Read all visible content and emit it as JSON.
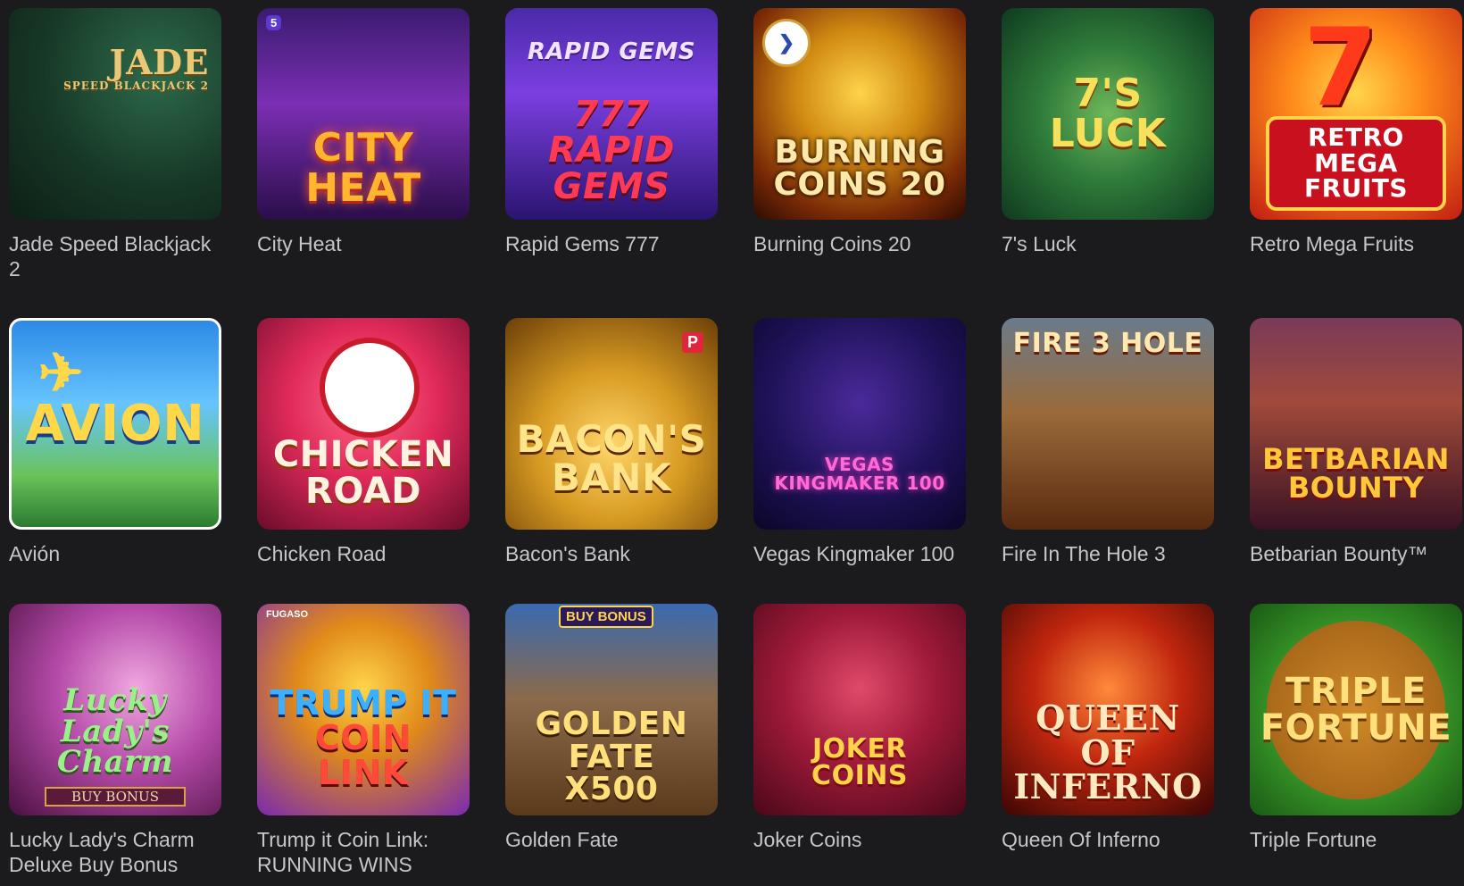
{
  "games": [
    {
      "title": "Jade Speed Blackjack 2",
      "art_text": "JADE",
      "art_sub": "SPEED BLACKJACK 2",
      "accent": "#e9c878"
    },
    {
      "title": "City Heat",
      "art_text": "CITY HEAT",
      "accent": "#ffb52e",
      "badge": "5"
    },
    {
      "title": "Rapid Gems 777",
      "art_top": "RAPID GEMS",
      "art_text": "777 RAPID GEMS",
      "accent": "#ff3a55"
    },
    {
      "title": "Burning Coins 20",
      "art_text": "BURNING COINS 20",
      "accent": "#ffe9a8"
    },
    {
      "title": "7's Luck",
      "art_text": "7'S LUCK",
      "accent": "#f7e15a"
    },
    {
      "title": "Retro Mega Fruits",
      "art_text": "RETRO MEGA FRUITS",
      "accent": "#c8101e"
    },
    {
      "title": "Avión",
      "art_text": "AVION",
      "accent": "#ffd84a"
    },
    {
      "title": "Chicken Road",
      "art_text": "CHICKEN ROAD",
      "accent": "#fff2e0"
    },
    {
      "title": "Bacon's Bank",
      "art_text": "BACON'S BANK",
      "accent": "#ffe48a",
      "badge": "P"
    },
    {
      "title": "Vegas Kingmaker 100",
      "art_text": "VEGAS KINGMAKER 100",
      "accent": "#ff6ad6"
    },
    {
      "title": "Fire In The Hole 3",
      "art_text": "FIRE 3 HOLE",
      "accent": "#ffe9b0"
    },
    {
      "title": "Betbarian Bounty™",
      "art_text": "BETBARIAN BOUNTY",
      "accent": "#ffc83a"
    },
    {
      "title": "Lucky Lady's Charm Deluxe Buy Bonus",
      "art_text": "Lucky Lady's Charm",
      "art_sub": "BUY BONUS",
      "accent": "#9bf08a"
    },
    {
      "title": "Trump it Coin Link: RUNNING WINS",
      "art_text": "TRUMP IT",
      "art_sub": "COIN LINK",
      "badge": "FUGASO",
      "accent": "#3ab0ff"
    },
    {
      "title": "Golden Fate",
      "art_text": "GOLDEN FATE x500",
      "badge": "BUY BONUS",
      "accent": "#ffe07a"
    },
    {
      "title": "Joker Coins",
      "art_text": "JOKER COINS",
      "accent": "#ffd34a"
    },
    {
      "title": "Queen Of Inferno",
      "art_text": "QUEEN OF INFERNO",
      "accent": "#ffe9c0"
    },
    {
      "title": "Triple Fortune",
      "art_text": "TRIPLE FORTUNE",
      "accent": "#ffe07a"
    }
  ]
}
